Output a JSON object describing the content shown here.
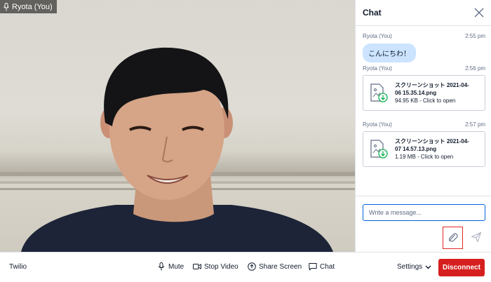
{
  "video": {
    "participant_label": "Ryota (You)"
  },
  "chat": {
    "title": "Chat",
    "messages": [
      {
        "author": "Ryota (You)",
        "time": "2:55 pm",
        "type": "text",
        "text": "こんにちわ！"
      },
      {
        "author": "Ryota (You)",
        "time": "2:56 pm",
        "type": "file",
        "file_name_line1": "スクリーンショット 2021-04-",
        "file_name_line2": "06 15.35.14.png",
        "file_info": "94.95 KB - Click to open"
      },
      {
        "author": "Ryota (You)",
        "time": "2:57 pm",
        "type": "file",
        "file_name_line1": "スクリーンショット 2021-04-",
        "file_name_line2": "07 14.57.13.png",
        "file_info": "1.19 MB - Click to open"
      }
    ],
    "input_placeholder": "Write a message..."
  },
  "toolbar": {
    "brand": "Twilio",
    "mute": "Mute",
    "stop_video": "Stop Video",
    "share_screen": "Share Screen",
    "chat": "Chat",
    "settings": "Settings",
    "disconnect": "Disconnect"
  },
  "colors": {
    "accent": "#0263e0",
    "bubble": "#cce4ff",
    "disconnect": "#d61f1f",
    "highlight": "#e02a24",
    "file_icon_green": "#14b053"
  }
}
